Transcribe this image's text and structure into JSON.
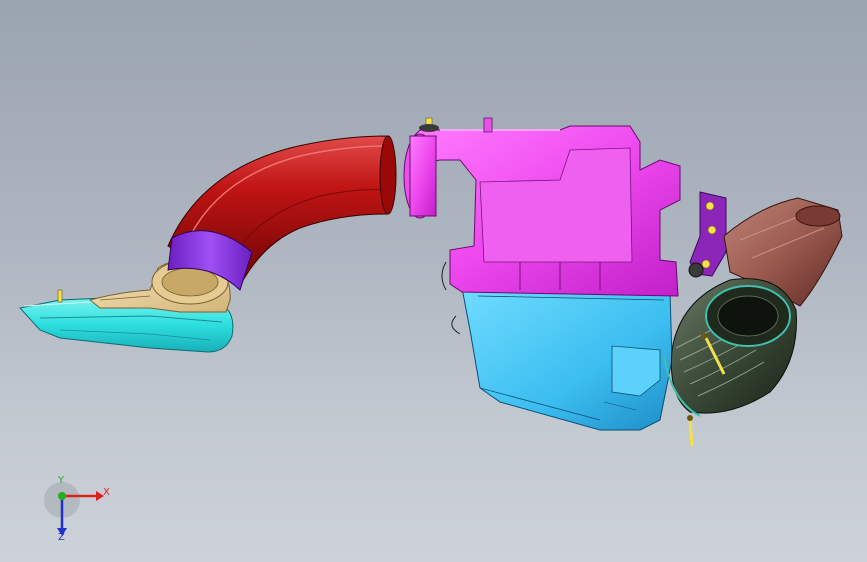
{
  "viewport": {
    "background_top": "#9aa3b0",
    "background_bottom": "#cdd2d9"
  },
  "model": {
    "colors": {
      "intake_duct_red": "#b00c0c",
      "filter_housing_magenta": "#ee48ee",
      "filter_housing_lower_cyan": "#42c6f4",
      "snorkel_cyan": "#2ee0e0",
      "snorkel_beige": "#ecd6a0",
      "coupler_purple": "#8e30e8",
      "bracket_purple": "#8b26b8",
      "bellows_hose_dark": "#3b4a38",
      "duct_adapter_brown": "#9b5a50",
      "bolts_yellow": "#f4e04a"
    }
  },
  "triad": {
    "x_label": "X",
    "y_label": "Y",
    "z_label": "Z",
    "x_color": "#e02020",
    "y_color": "#20b020",
    "z_color": "#2030d0"
  }
}
